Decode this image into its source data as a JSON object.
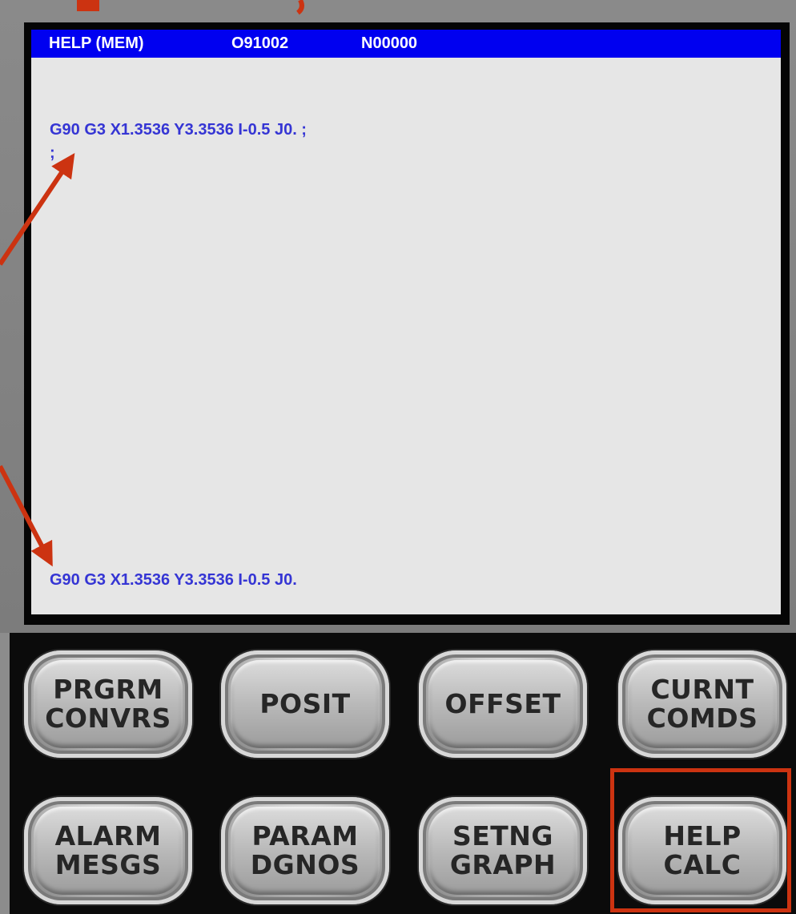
{
  "status_bar": {
    "mode": "HELP (MEM)",
    "program_number": "O91002",
    "sequence_number": "N00000"
  },
  "editor": {
    "program_lines": [
      "G90 G3 X1.3536 Y3.3536 I-0.5 J0. ;",
      ";"
    ],
    "input_buffer": "G90 G3 X1.3536 Y3.3536 I-0.5 J0."
  },
  "softkeys": {
    "row1": [
      {
        "line1": "PRGRM",
        "line2": "CONVRS"
      },
      {
        "line1": "POSIT",
        "line2": ""
      },
      {
        "line1": "OFFSET",
        "line2": ""
      },
      {
        "line1": "CURNT",
        "line2": "COMDS"
      }
    ],
    "row2": [
      {
        "line1": "ALARM",
        "line2": "MESGS"
      },
      {
        "line1": "PARAM",
        "line2": "DGNOS"
      },
      {
        "line1": "SETNG",
        "line2": "GRAPH"
      },
      {
        "line1": "HELP",
        "line2": "CALC"
      }
    ],
    "highlighted": "HELP CALC"
  },
  "colors": {
    "status_bar_bg": "#0000f0",
    "program_text": "#3535d4",
    "screen_bg": "#e6e6e6",
    "annotation": "#cc3311"
  }
}
